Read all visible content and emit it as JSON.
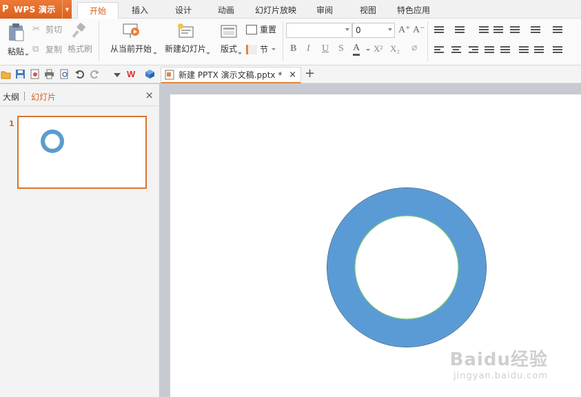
{
  "app": {
    "name": "WPS 演示",
    "logo": "P"
  },
  "menu_tabs": [
    {
      "label": "开始",
      "active": true
    },
    {
      "label": "插入"
    },
    {
      "label": "设计"
    },
    {
      "label": "动画"
    },
    {
      "label": "幻灯片放映"
    },
    {
      "label": "审阅"
    },
    {
      "label": "视图"
    },
    {
      "label": "特色应用"
    }
  ],
  "ribbon": {
    "paste": "粘贴",
    "cut": "剪切",
    "copy": "复制",
    "format_painter": "格式刷",
    "from_current": "从当前开始",
    "new_slide": "新建幻灯片",
    "layout": "版式",
    "reset": "重置",
    "section": "节",
    "font_name": "",
    "font_size": "0",
    "bold": "B",
    "italic": "I",
    "underline": "U",
    "strike": "S",
    "font_color": "A",
    "superscript": "X²",
    "subscript": "X₂",
    "grow_font": "A⁺",
    "shrink_font": "A⁻"
  },
  "document": {
    "title": "新建 PPTX 演示文稿.pptx *",
    "close": "×",
    "new_tab": "+"
  },
  "left_panel": {
    "outline_tab": "大纲",
    "slides_tab": "幻灯片",
    "close": "×",
    "slide_number": "1"
  },
  "colors": {
    "accent": "#d4601e",
    "ring": "#5b9bd5",
    "ring_inner_border": "#7ac87a"
  },
  "watermark": {
    "main": "Baidu经验",
    "sub": "jingyan.baidu.com"
  }
}
